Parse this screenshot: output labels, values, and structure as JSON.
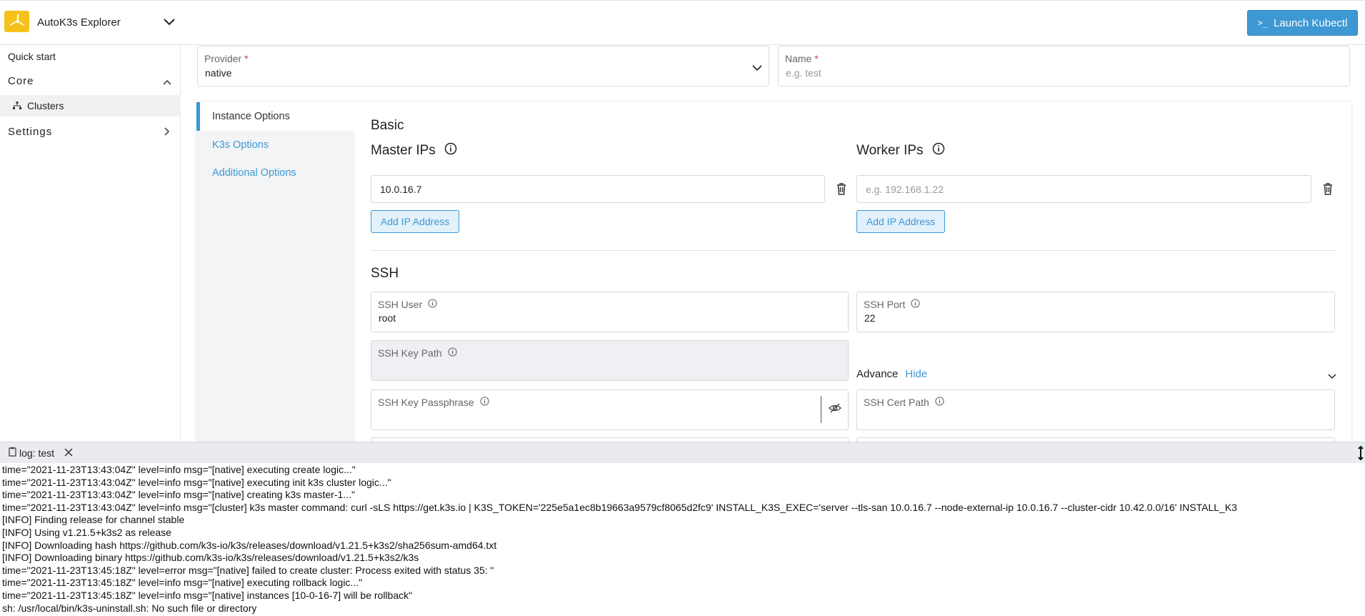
{
  "header": {
    "app_title": "AutoK3s Explorer",
    "launch_button": "Launch Kubectl",
    "launch_icon": "terminal-icon"
  },
  "sidebar": {
    "quick_start": "Quick start",
    "core_label": "Core",
    "clusters_label": "Clusters",
    "settings_label": "Settings"
  },
  "form": {
    "provider": {
      "label": "Provider",
      "required_mark": "*",
      "value": "native"
    },
    "name": {
      "label": "Name",
      "required_mark": "*",
      "placeholder": "e.g. test"
    }
  },
  "tabs": [
    {
      "label": "Instance Options",
      "active": true
    },
    {
      "label": "K3s Options",
      "active": false
    },
    {
      "label": "Additional Options",
      "active": false
    }
  ],
  "basic": {
    "title": "Basic",
    "master_ips": {
      "title": "Master IPs",
      "value": "10.0.16.7",
      "add_button": "Add IP Address"
    },
    "worker_ips": {
      "title": "Worker IPs",
      "placeholder": "e.g. 192.168.1.22",
      "add_button": "Add IP Address"
    }
  },
  "ssh": {
    "title": "SSH",
    "user": {
      "label": "SSH User",
      "value": "root"
    },
    "port": {
      "label": "SSH Port",
      "value": "22"
    },
    "key_path": {
      "label": "SSH Key Path",
      "value": ""
    },
    "advance": {
      "label": "Advance",
      "toggle": "Hide"
    },
    "key_passphrase": {
      "label": "SSH Key Passphrase",
      "value": ""
    },
    "cert_path": {
      "label": "SSH Cert Path",
      "value": ""
    }
  },
  "log": {
    "tab_label": "log: test",
    "lines": [
      "time=\"2021-11-23T13:43:04Z\" level=info msg=\"[native] executing create logic...\"",
      "time=\"2021-11-23T13:43:04Z\" level=info msg=\"[native] executing init k3s cluster logic...\"",
      "time=\"2021-11-23T13:43:04Z\" level=info msg=\"[native] creating k3s master-1...\"",
      "time=\"2021-11-23T13:43:04Z\" level=info msg=\"[cluster] k3s master command: curl -sLS https://get.k3s.io | K3S_TOKEN='225e5a1ec8b19663a9579cf8065d2fc9' INSTALL_K3S_EXEC='server --tls-san 10.0.16.7 --node-external-ip 10.0.16.7 --cluster-cidr 10.42.0.0/16' INSTALL_K3",
      "[INFO] Finding release for channel stable",
      "[INFO] Using v1.21.5+k3s2 as release",
      "[INFO] Downloading hash https://github.com/k3s-io/k3s/releases/download/v1.21.5+k3s2/sha256sum-amd64.txt",
      "[INFO] Downloading binary https://github.com/k3s-io/k3s/releases/download/v1.21.5+k3s2/k3s",
      "time=\"2021-11-23T13:45:18Z\" level=error msg=\"[native] failed to create cluster: Process exited with status 35: \"",
      "time=\"2021-11-23T13:45:18Z\" level=info msg=\"[native] executing rollback logic...\"",
      "time=\"2021-11-23T13:45:18Z\" level=info msg=\"[native] instances [10-0-16-7] will be rollback\"",
      "sh: /usr/local/bin/k3s-uninstall.sh: No such file or directory"
    ]
  },
  "colors": {
    "accent": "#3d98d3",
    "logo": "#f5c21a",
    "required": "#e0323a"
  }
}
